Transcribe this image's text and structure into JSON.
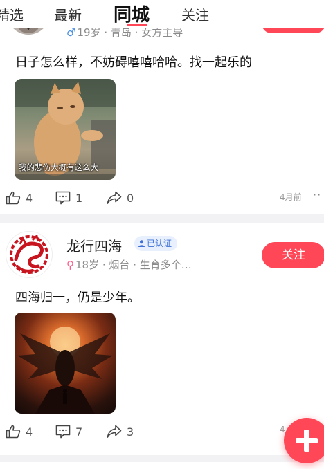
{
  "tabs": [
    {
      "label": "精选",
      "active": false
    },
    {
      "label": "最新",
      "active": false
    },
    {
      "label": "同城",
      "active": true
    },
    {
      "label": "关注",
      "active": false
    }
  ],
  "accent_color": "#ff4757",
  "posts": [
    {
      "user_meta": {
        "gender_icon": "male-symbol-icon",
        "age": "19岁",
        "city": "青岛",
        "extra": "女方主导"
      },
      "text": "日子怎么样，不妨碍嘻嘻哈哈。找一起乐的",
      "image_caption": "我的悲伤大概有这么大",
      "likes": "4",
      "comments": "1",
      "shares": "0",
      "time": "4月前"
    },
    {
      "user_name": "龙行四海",
      "verified_label": "已认证",
      "follow_label": "关注",
      "user_meta": {
        "gender_icon": "female-symbol-icon",
        "age": "18岁",
        "city": "烟台",
        "extra": "生育多个…"
      },
      "text": "四海归一，仍是少年。",
      "likes": "4",
      "comments": "7",
      "shares": "3",
      "time": "4"
    }
  ],
  "fab_icon": "plus-icon"
}
